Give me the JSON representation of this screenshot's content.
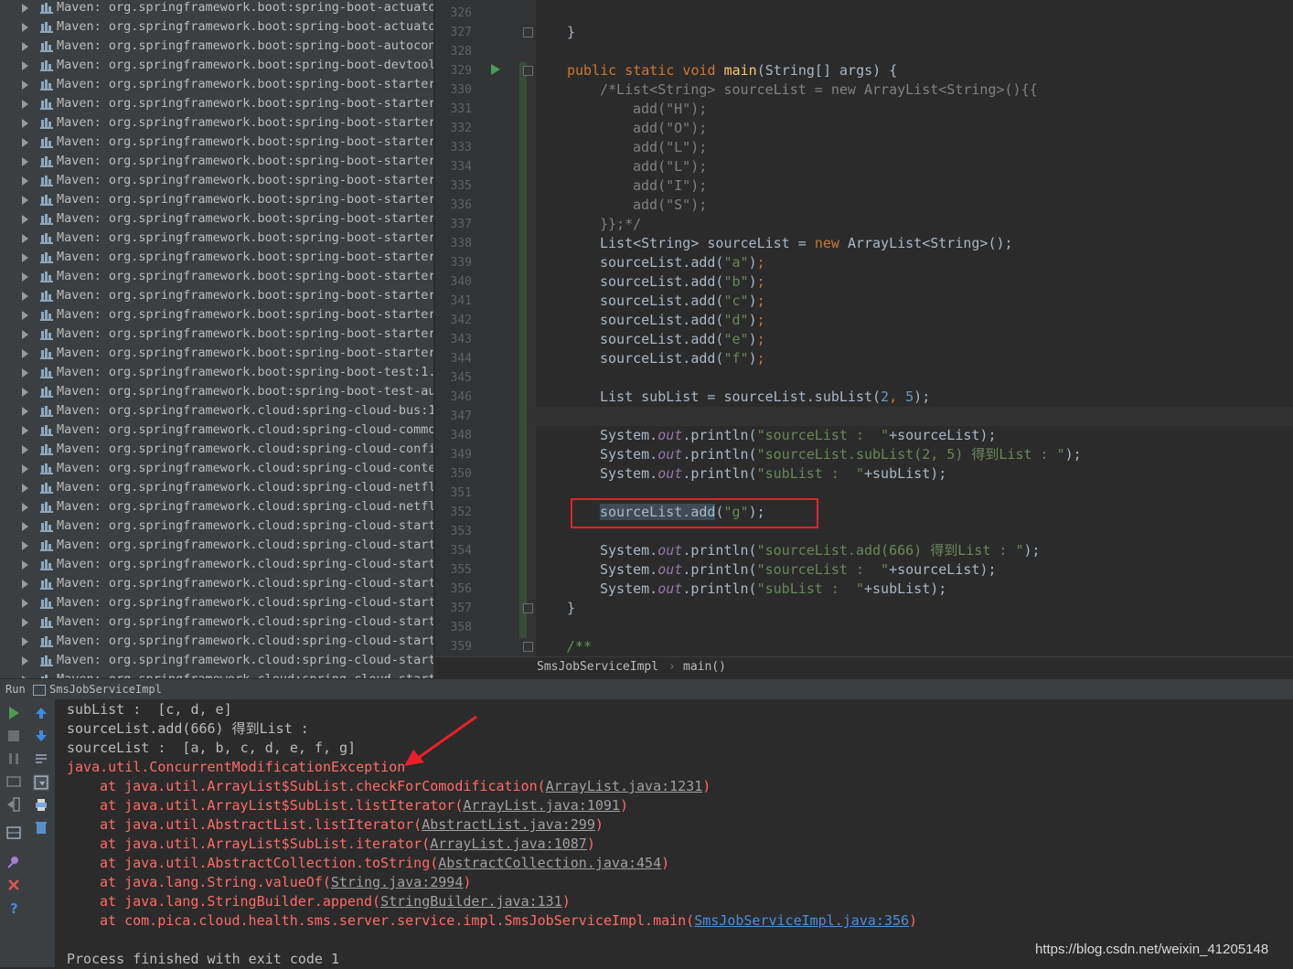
{
  "project_tree": {
    "items": [
      "Maven: org.springframework.boot:spring-boot-actuator",
      "Maven: org.springframework.boot:spring-boot-actuator",
      "Maven: org.springframework.boot:spring-boot-autoconf",
      "Maven: org.springframework.boot:spring-boot-devtools",
      "Maven: org.springframework.boot:spring-boot-starter-",
      "Maven: org.springframework.boot:spring-boot-starter-",
      "Maven: org.springframework.boot:spring-boot-starter-",
      "Maven: org.springframework.boot:spring-boot-starter-",
      "Maven: org.springframework.boot:spring-boot-starter-",
      "Maven: org.springframework.boot:spring-boot-starter-",
      "Maven: org.springframework.boot:spring-boot-starter-",
      "Maven: org.springframework.boot:spring-boot-starter-",
      "Maven: org.springframework.boot:spring-boot-starter-",
      "Maven: org.springframework.boot:spring-boot-starter-",
      "Maven: org.springframework.boot:spring-boot-starter-",
      "Maven: org.springframework.boot:spring-boot-starter-",
      "Maven: org.springframework.boot:spring-boot-starter-",
      "Maven: org.springframework.boot:spring-boot-starter-",
      "Maven: org.springframework.boot:spring-boot-starter-",
      "Maven: org.springframework.boot:spring-boot-test:1.5",
      "Maven: org.springframework.boot:spring-boot-test-aut",
      "Maven: org.springframework.cloud:spring-cloud-bus:1.",
      "Maven: org.springframework.cloud:spring-cloud-common",
      "Maven: org.springframework.cloud:spring-cloud-config",
      "Maven: org.springframework.cloud:spring-cloud-contex",
      "Maven: org.springframework.cloud:spring-cloud-netfli",
      "Maven: org.springframework.cloud:spring-cloud-netfli",
      "Maven: org.springframework.cloud:spring-cloud-starte",
      "Maven: org.springframework.cloud:spring-cloud-starte",
      "Maven: org.springframework.cloud:spring-cloud-starte",
      "Maven: org.springframework.cloud:spring-cloud-starte",
      "Maven: org.springframework.cloud:spring-cloud-starte",
      "Maven: org.springframework.cloud:spring-cloud-starte",
      "Maven: org.springframework.cloud:spring-cloud-starte",
      "Maven: org.springframework.cloud:spring-cloud-starte",
      "Maven: org.springframework.cloud:spring-cloud-starte"
    ]
  },
  "editor": {
    "line_numbers": [
      "326",
      "327",
      "328",
      "329",
      "330",
      "331",
      "332",
      "333",
      "334",
      "335",
      "336",
      "337",
      "338",
      "339",
      "340",
      "341",
      "342",
      "343",
      "344",
      "345",
      "346",
      "347",
      "348",
      "349",
      "350",
      "351",
      "352",
      "353",
      "354",
      "355",
      "356",
      "357",
      "358",
      "359"
    ],
    "lines": {
      "l327": "}",
      "l329a": "public static void ",
      "l329b": "main",
      "l329c": "(String[] args) {",
      "l330": "/*List<String> sourceList = new ArrayList<String>(){{",
      "l331": "add(\"H\");",
      "l332": "add(\"O\");",
      "l333": "add(\"L\");",
      "l334": "add(\"L\");",
      "l335": "add(\"I\");",
      "l336": "add(\"S\");",
      "l337": "}};*/",
      "l338a": "List<String> sourceList = ",
      "l338b": "new ",
      "l338c": "ArrayList<String>();",
      "add_prefix": "sourceList.add(",
      "add_suffix_close": ")",
      "semi": ";",
      "a": "\"a\"",
      "b": "\"b\"",
      "c": "\"c\"",
      "d": "\"d\"",
      "e": "\"e\"",
      "f": "\"f\"",
      "g": "\"g\"",
      "l346a": "List subList = sourceList.subList(",
      "l346n1": "2",
      "l346comma": ", ",
      "l346n2": "5",
      "l346end": ");",
      "sys": "System.",
      "out": "out",
      "println": ".println(",
      "s348": "\"sourceList :  \"",
      "r348": "+sourceList);",
      "s349": "\"sourceList.subList(2, 5) 得到List : \"",
      "r349": ");",
      "s350": "\"subList :  \"",
      "r350": "+subList);",
      "l352sel": "sourceList.add",
      "l352b": "(",
      "l352c": ");",
      "s354": "\"sourceList.add(666) 得到List : \"",
      "r354": ");",
      "s355": "\"sourceList :  \"",
      "r355": "+sourceList);",
      "s356": "\"subList :  \"",
      "r356": "+subList);",
      "l357": "}",
      "l359": "/**"
    },
    "breadcrumb": {
      "class": "SmsJobServiceImpl",
      "separator": "›",
      "method": "main()"
    }
  },
  "run_panel": {
    "tab_label": "Run",
    "config_name": "SmsJobServiceImpl",
    "console": {
      "l1": "subList :  [c, d, e]",
      "l2": "sourceList.add(666) 得到List :",
      "l3": "sourceList :  [a, b, c, d, e, f, g]",
      "exception": "java.util.ConcurrentModificationException",
      "at": "at ",
      "st1_m": "java.util.ArrayList$SubList.checkForComodification(",
      "st1_l": "ArrayList.java:1231",
      "st2_m": "java.util.ArrayList$SubList.listIterator(",
      "st2_l": "ArrayList.java:1091",
      "st3_m": "java.util.AbstractList.listIterator(",
      "st3_l": "AbstractList.java:299",
      "st4_m": "java.util.ArrayList$SubList.iterator(",
      "st4_l": "ArrayList.java:1087",
      "st5_m": "java.util.AbstractCollection.toString(",
      "st5_l": "AbstractCollection.java:454",
      "st6_m": "java.lang.String.valueOf(",
      "st6_l": "String.java:2994",
      "st7_m": "java.lang.StringBuilder.append(",
      "st7_l": "StringBuilder.java:131",
      "st8_m": "com.pica.cloud.health.sms.server.service.impl.SmsJobServiceImpl.main(",
      "st8_l": "SmsJobServiceImpl.java:356",
      "close": ")",
      "finished": "Process finished with exit code 1"
    }
  },
  "watermark": "https://blog.csdn.net/weixin_41205148",
  "colors": {
    "annotation_red": "#e8202a",
    "error_text": "#ff6b68",
    "link_blue": "#4a8fd8"
  }
}
